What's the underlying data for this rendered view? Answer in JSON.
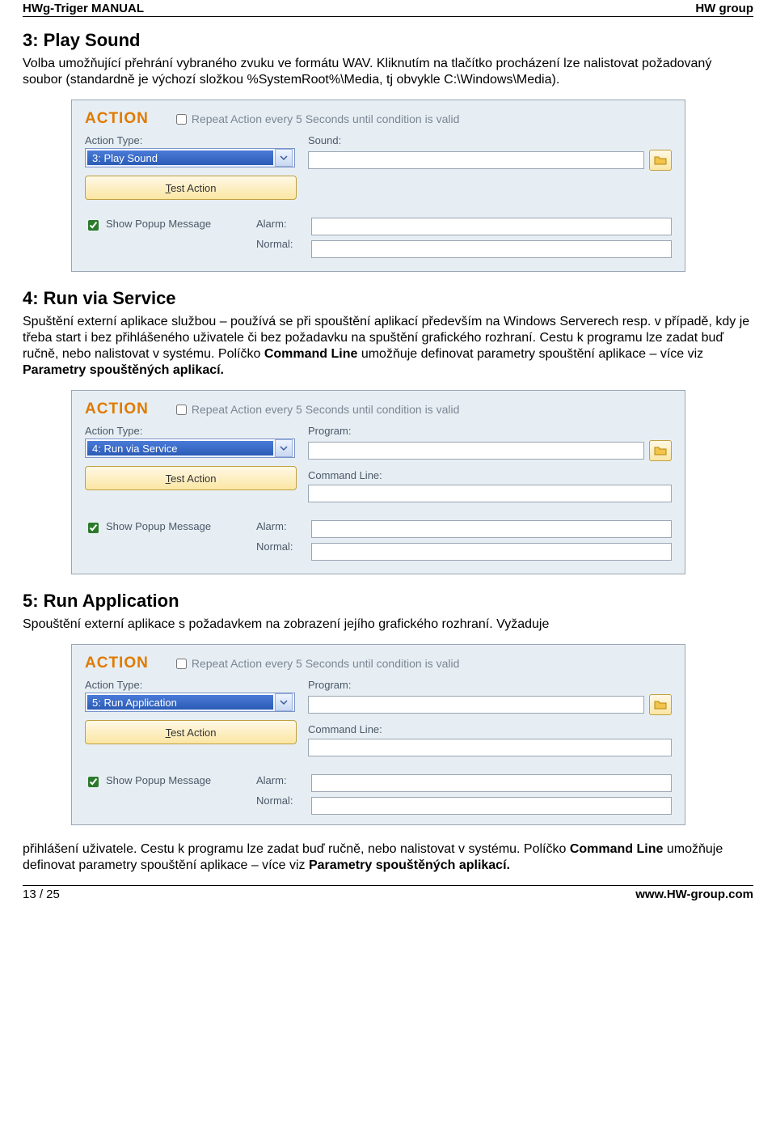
{
  "header": {
    "title_left": "HWg-Triger MANUAL",
    "title_right": "HW group"
  },
  "footer": {
    "page": "13 / 25",
    "url": "www.HW-group.com"
  },
  "s3": {
    "title": "3: Play Sound",
    "para": "Volba umožňující přehrání vybraného zvuku ve formátu WAV. Kliknutím na tlačítko procházení lze nalistovat požadovaný soubor (standardně je výchozí složkou %SystemRoot%\\Media, tj obvykle C:\\Windows\\Media).",
    "panel": {
      "action_title": "ACTION",
      "repeat_label": "Repeat Action every 5 Seconds until condition is valid",
      "action_type_label": "Action Type:",
      "action_type_value": "3: Play Sound",
      "test_action": "Test Action",
      "sound_label": "Sound:",
      "show_popup": "Show Popup Message",
      "alarm_label": "Alarm:",
      "normal_label": "Normal:"
    }
  },
  "s4": {
    "title": "4: Run via Service",
    "para_before": "Spuštění externí aplikace službou – používá se při spouštění aplikací především na Windows Serverech resp. v případě, kdy je třeba start i bez přihlášeného uživatele či bez požadavku na spuštění grafického rozhraní.\nCestu k programu lze zadat buď ručně, nebo nalistovat v systému. Políčko ",
    "bold1": "Command Line",
    "mid": " umožňuje definovat parametry spouštění aplikace – více viz ",
    "bold2": "Parametry spouštěných aplikací.",
    "panel": {
      "action_title": "ACTION",
      "repeat_label": "Repeat Action every 5 Seconds until condition is valid",
      "action_type_label": "Action Type:",
      "action_type_value": "4: Run via Service",
      "test_action": "Test Action",
      "program_label": "Program:",
      "cmd_label": "Command Line:",
      "show_popup": "Show Popup Message",
      "alarm_label": "Alarm:",
      "normal_label": "Normal:"
    }
  },
  "s5": {
    "title": "5: Run Application",
    "para_top": "Spouštění externí aplikace s požadavkem na zobrazení jejího grafického rozhraní. Vyžaduje",
    "panel": {
      "action_title": "ACTION",
      "repeat_label": "Repeat Action every 5 Seconds until condition is valid",
      "action_type_label": "Action Type:",
      "action_type_value": "5: Run Application",
      "test_action": "Test Action",
      "program_label": "Program:",
      "cmd_label": "Command Line:",
      "show_popup": "Show Popup Message",
      "alarm_label": "Alarm:",
      "normal_label": "Normal:"
    },
    "para_bottom_before": "přihlášení uživatele. Cestu k programu lze zadat buď ručně, nebo nalistovat v systému. Políčko ",
    "bold1": "Command Line",
    "mid": " umožňuje definovat parametry spouštění aplikace – více viz ",
    "bold2": "Parametry spouštěných aplikací."
  }
}
